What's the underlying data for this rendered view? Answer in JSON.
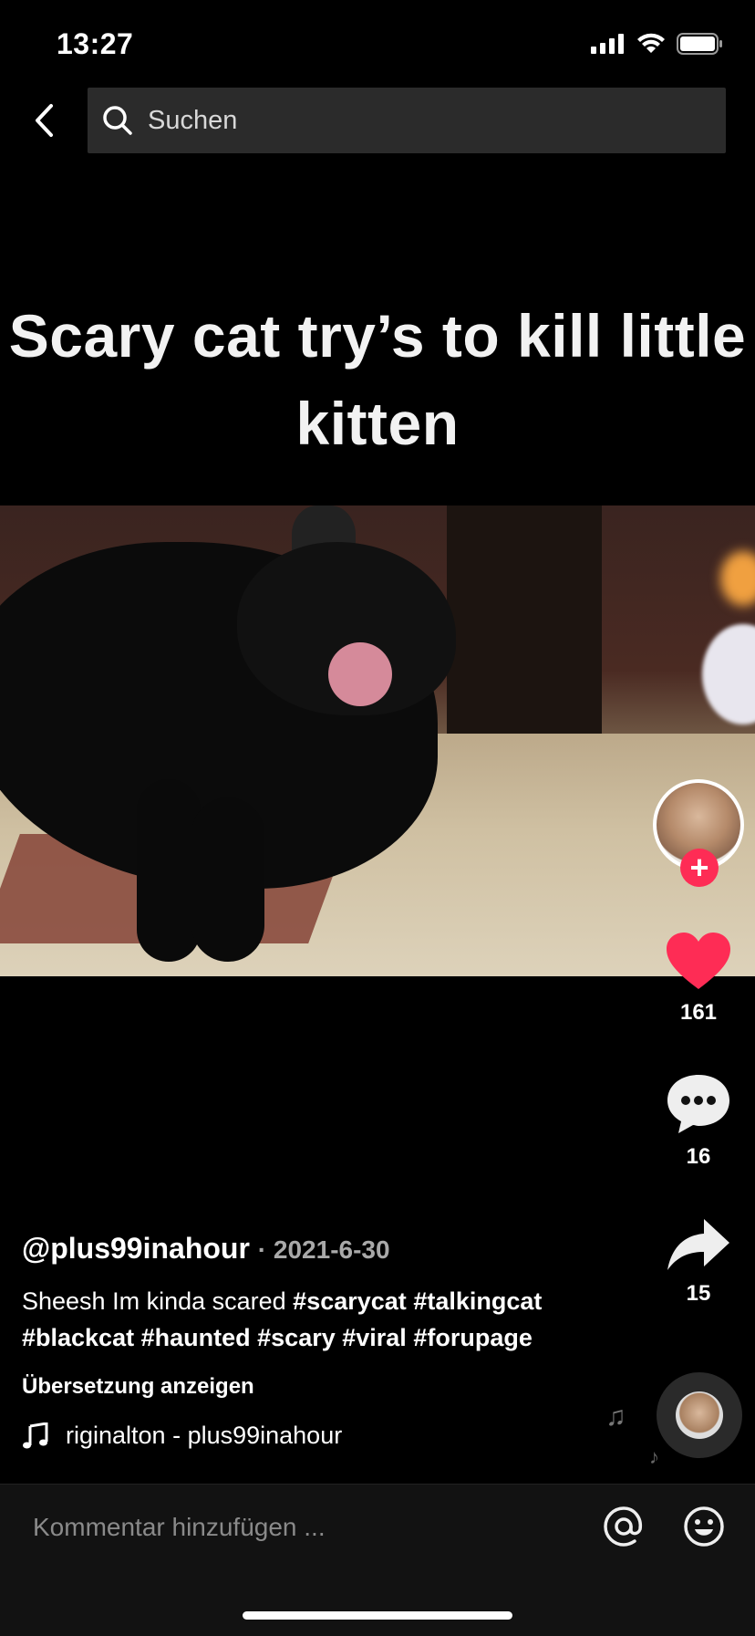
{
  "status_bar": {
    "time": "13:27"
  },
  "search": {
    "placeholder": "Suchen"
  },
  "video": {
    "caption_line1": "Scary cat try’s to kill little",
    "caption_line2": "kitten"
  },
  "actions": {
    "likes": "161",
    "comments": "16",
    "shares": "15"
  },
  "post": {
    "username": "@plus99inahour",
    "date": "· 2021-6-30",
    "description_text": "Sheesh Im kinda scared ",
    "hashtags": [
      "#scarycat",
      "#talkingcat",
      "#blackcat",
      "#haunted",
      "#scary",
      "#viral",
      "#forupage"
    ],
    "translate_label": "Übersetzung anzeigen",
    "sound": "riginalton - plus99inahour"
  },
  "comment_bar": {
    "placeholder": "Kommentar hinzufügen ..."
  },
  "colors": {
    "accent": "#fe2c55",
    "background": "#000000",
    "search_bg": "#2b2b2b"
  },
  "icons": [
    "back-icon",
    "search-icon",
    "signal-icon",
    "wifi-icon",
    "battery-icon",
    "heart-icon",
    "comment-icon",
    "share-icon",
    "music-note-icon",
    "mention-icon",
    "emoji-icon"
  ]
}
